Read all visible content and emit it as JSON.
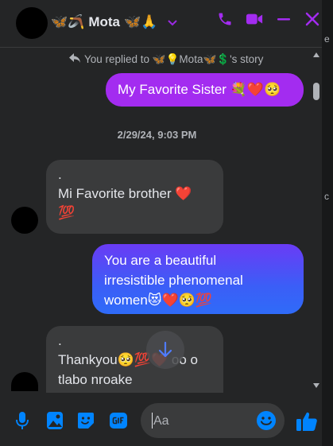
{
  "header": {
    "name": "Mota",
    "name_prefix": "🦋🪃",
    "name_suffix": "🦋🙏"
  },
  "right_strip": {
    "chars": [
      "e",
      "c"
    ]
  },
  "reply_note": "You replied to 🦋💡Mota🦋💲's story",
  "messages": {
    "out1": {
      "text": "My Favorite Sister 💐❤️🥺"
    },
    "timestamp": "2/29/24, 9:03 PM",
    "in1": {
      "line1": ".",
      "line2": "Mi Favorite brother ❤️",
      "line3": "💯"
    },
    "out2": {
      "line1": "You are a beautiful",
      "line2": "irresistible phenomenal",
      "line3": "women😻❤️🥺💯"
    },
    "in2": {
      "line1": ".",
      "line2": "Thankyou🥺💯❤️ oo o",
      "line3": "tlabo nroake"
    }
  },
  "composer": {
    "placeholder": "Aa"
  },
  "colors": {
    "accent": "#a32cf0",
    "blue": "#0084ff",
    "bubble_in": "#3a3b3c",
    "bg": "#242526"
  }
}
